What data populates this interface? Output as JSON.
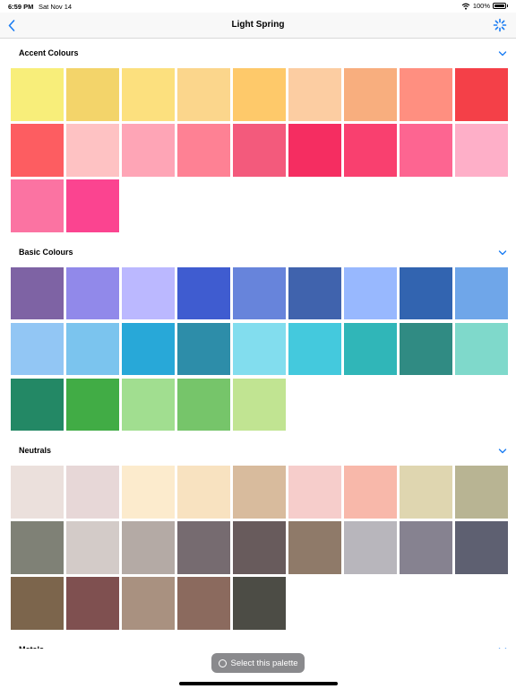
{
  "status": {
    "time": "6:59 PM",
    "date": "Sat Nov 14",
    "battery": "100%"
  },
  "nav": {
    "title": "Light Spring"
  },
  "sections": [
    {
      "title": "Accent Colours",
      "colors": [
        "#f8ee7a",
        "#f3d46a",
        "#fce07e",
        "#fbd68c",
        "#fec96a",
        "#fccda2",
        "#f8ae7e",
        "#ff8f80",
        "#f44048",
        "#fd5d61",
        "#fec2c3",
        "#fea5b6",
        "#fe8194",
        "#f35a7c",
        "#f52d61",
        "#f9406f",
        "#fd6591",
        "#feafc8",
        "#fb73a2",
        "#fb4490"
      ]
    },
    {
      "title": "Basic Colours",
      "colors": [
        "#7e63a4",
        "#9189ea",
        "#bbb8ff",
        "#3f5cd0",
        "#6784db",
        "#4063ad",
        "#98b8fe",
        "#3264b0",
        "#6fa6e9",
        "#92c6f4",
        "#7bc4ee",
        "#28a8d8",
        "#2d8da9",
        "#82ddee",
        "#44c9dd",
        "#30b6b8",
        "#308b83",
        "#7fd9cb",
        "#238865",
        "#41ac45",
        "#a1de90",
        "#76c56a",
        "#c1e492"
      ]
    },
    {
      "title": "Neutrals",
      "colors": [
        "#ebe0dc",
        "#e7d7d7",
        "#fcebcd",
        "#f8e2c0",
        "#d8bb9d",
        "#f6cdcb",
        "#f8b8aa",
        "#dfd6b0",
        "#b8b493",
        "#7f8176",
        "#d3cbc8",
        "#b4aaa5",
        "#766b70",
        "#685b5c",
        "#8f7a69",
        "#b8b6bc",
        "#868290",
        "#5e6071",
        "#7c654c",
        "#7f5050",
        "#a99180",
        "#8b6a5e",
        "#4c4c45"
      ]
    },
    {
      "title": "Metals",
      "colors": []
    }
  ],
  "footer": {
    "select_label": "Select this palette"
  },
  "icons": {
    "back": "chevron-left-icon",
    "action": "spinner-icon",
    "chevron": "chevron-down-icon",
    "wifi": "wifi-icon"
  },
  "accent_color": "#1a7cf2"
}
